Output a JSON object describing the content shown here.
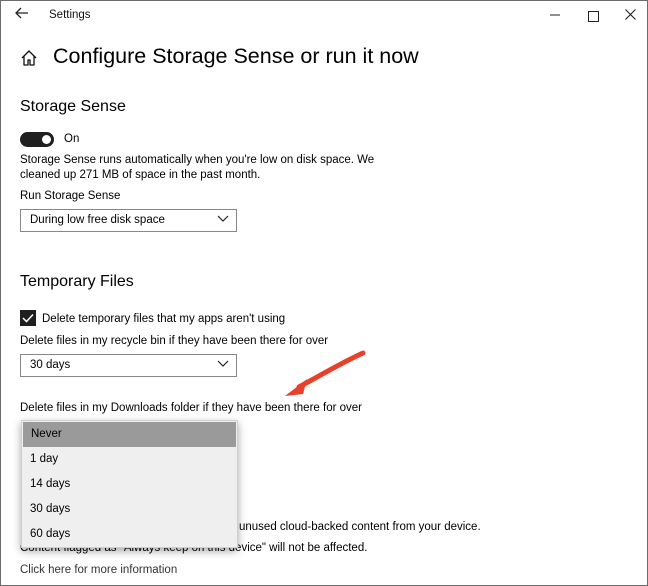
{
  "window": {
    "title": "Settings",
    "minimize_icon": "minimize-icon",
    "maximize_icon": "maximize-icon",
    "close_icon": "close-icon"
  },
  "header": {
    "title": "Configure Storage Sense or run it now"
  },
  "storage_sense": {
    "heading": "Storage Sense",
    "toggle_label": "On",
    "toggle_on": true,
    "description_line1": "Storage Sense runs automatically when you're low on disk space. We",
    "description_line2": "cleaned up 271 MB of space in the past month.",
    "run_label": "Run Storage Sense",
    "run_value": "During low free disk space"
  },
  "temporary_files": {
    "heading": "Temporary Files",
    "delete_temp_label": "Delete temporary files that my apps aren't using",
    "delete_temp_checked": true,
    "recycle_label": "Delete files in my recycle bin if they have been there for over",
    "recycle_value": "30 days",
    "downloads_label": "Delete files in my Downloads folder if they have been there for over"
  },
  "downloads_dropdown": {
    "options": [
      "Never",
      "1 day",
      "14 days",
      "30 days",
      "60 days"
    ],
    "selected": "Never"
  },
  "cloud": {
    "partial_line1": "unused cloud-backed content from your device.",
    "partial_line2": "Content flagged as \"Always keep on this device\" will not be affected.",
    "link": "Click here for more information"
  },
  "colors": {
    "arrow": "#e8402a",
    "selected_option": "#9a9a9a",
    "toggle": "#1f1f1f"
  }
}
